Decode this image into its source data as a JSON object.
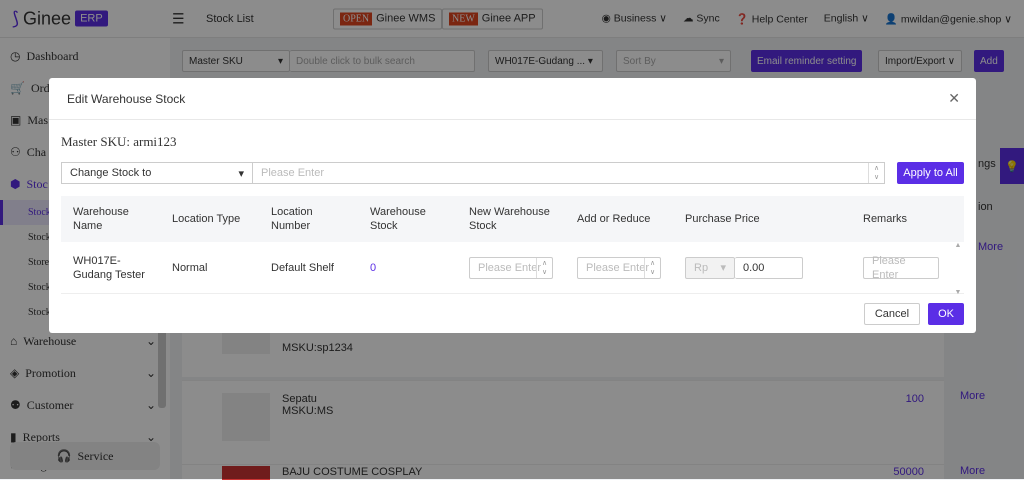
{
  "header": {
    "logo": "Ginee",
    "logo_badge": "ERP",
    "page": "Stock List",
    "wms_badge": "OPEN",
    "wms": "Ginee WMS",
    "app_badge": "NEW",
    "app": "Ginee APP",
    "business": "Business",
    "sync": "Sync",
    "help": "Help Center",
    "lang": "English",
    "user": "mwildan@genie.shop"
  },
  "sidebar": {
    "items": [
      {
        "label": "Dashboard",
        "icon": "dashboard-icon"
      },
      {
        "label": "Orde",
        "icon": "cart-icon"
      },
      {
        "label": "Mas",
        "icon": "bag-icon"
      },
      {
        "label": "Cha",
        "icon": "channel-icon"
      },
      {
        "label": "Stoc",
        "icon": "box-icon"
      }
    ],
    "sub": [
      "Stock",
      "Stock",
      "Store",
      "Stock",
      "Stock"
    ],
    "groups": [
      "Warehouse",
      "Promotion",
      "Customer",
      "Reports",
      "Logistics"
    ],
    "service": "Service"
  },
  "filters": {
    "type": "Master SKU",
    "search_placeholder": "Double click to bulk search",
    "warehouse": "WH017E-Gudang ...",
    "sort": "Sort By",
    "email": "Email reminder setting",
    "import": "Import/Export",
    "add": "Add"
  },
  "bg_rows": [
    {
      "sku": "MSKU:sp1234"
    },
    {
      "name": "Sepatu",
      "sku": "MSKU:MS",
      "stock": "100",
      "more": "More"
    },
    {
      "name": "BAJU COSTUME COSPLAY",
      "stock": "50000",
      "more": "More"
    }
  ],
  "right_partial": {
    "a": "ngs",
    "b": "ion",
    "more": "More"
  },
  "modal": {
    "title": "Edit Warehouse Stock",
    "sku": "Master SKU: armi123",
    "mode": "Change Stock to",
    "placeholder": "Please Enter",
    "apply": "Apply to All",
    "headers": [
      "Warehouse Name",
      "Location Type",
      "Location Number",
      "Warehouse Stock",
      "New Warehouse Stock",
      "Add or Reduce",
      "Purchase Price",
      "Remarks"
    ],
    "row": {
      "name": "WH017E-Gudang Tester",
      "type": "Normal",
      "location": "Default Shelf",
      "stock": "0",
      "currency": "Rp",
      "price": "0.00"
    },
    "cancel": "Cancel",
    "ok": "OK"
  },
  "colors": {
    "accent": "#5b2ee6"
  }
}
